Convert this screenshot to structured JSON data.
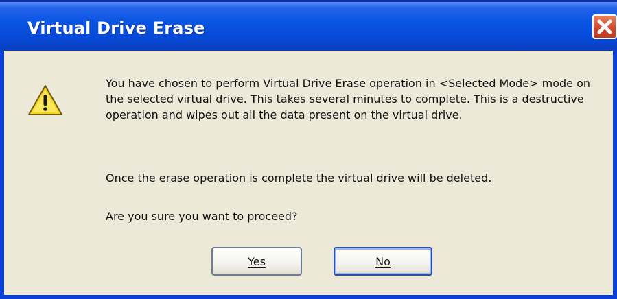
{
  "dialog": {
    "title": "Virtual Drive Erase",
    "close_icon": "close-icon",
    "warning_icon": "warning-icon",
    "message_paragraph_1": "You have chosen to perform Virtual Drive Erase operation in <Selected Mode> mode on the selected virtual drive. This takes several minutes to complete. This is a destructive operation and wipes out all the data present on the virtual drive.",
    "message_paragraph_2": "Once the erase operation is complete the virtual drive will be deleted.",
    "message_paragraph_3": "Are you sure you want to proceed?",
    "yes_label": "Yes",
    "no_label": "No"
  },
  "colors": {
    "titlebar": "#0a55e3",
    "frame": "#0a3fd8",
    "body": "#ece9d8",
    "close": "#d2442a",
    "warning": "#f6d21c"
  }
}
